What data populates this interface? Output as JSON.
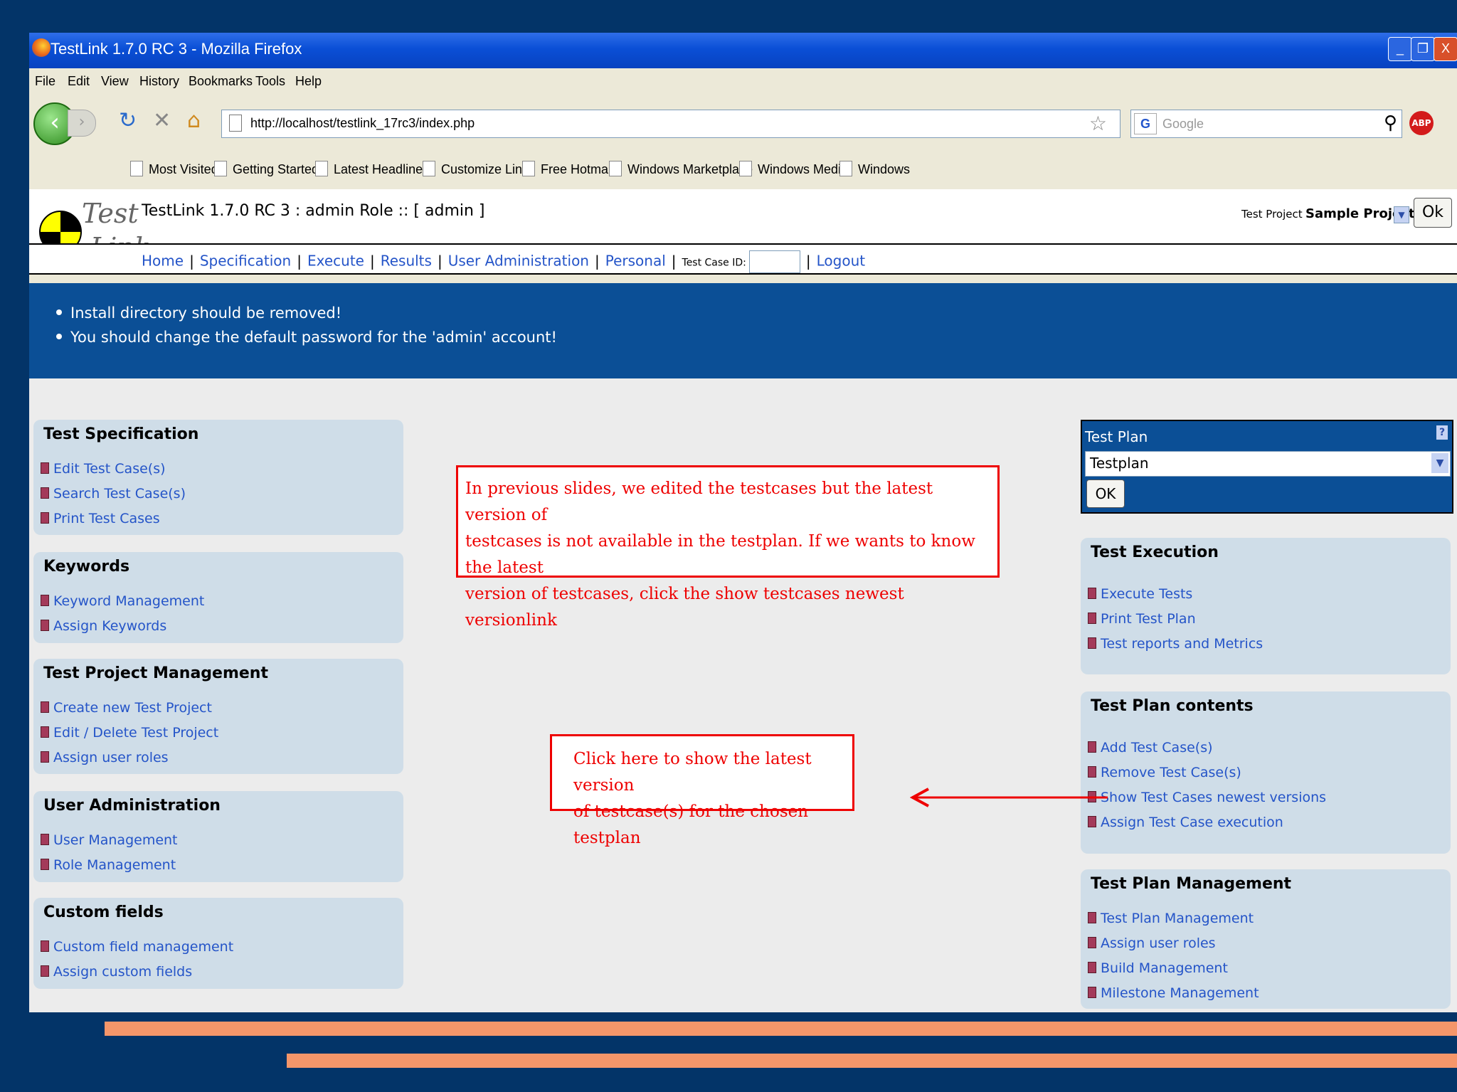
{
  "window": {
    "title": "TestLink 1.7.0 RC 3 - Mozilla Firefox"
  },
  "menu": [
    "File",
    "Edit",
    "View",
    "History",
    "Bookmarks",
    "Tools",
    "Help"
  ],
  "nav": {
    "url": "http://localhost/testlink_17rc3/index.php",
    "search_placeholder": "Google"
  },
  "bookmarks": [
    "Most Visited",
    "Getting Started",
    "Latest Headlines",
    "Customize Links",
    "Free Hotmail",
    "Windows Marketplace",
    "Windows Media",
    "Windows"
  ],
  "testlink": {
    "logo": {
      "word1": "Test",
      "word2": "Link"
    },
    "title": "TestLink 1.7.0 RC 3 : admin Role :: [ admin ]",
    "project_label": "Test Project",
    "project_value": "Sample Project",
    "ok_label": "Ok",
    "nav": {
      "home": "Home",
      "specification": "Specification",
      "execute": "Execute",
      "results": "Results",
      "user_admin": "User Administration",
      "personal": "Personal",
      "testcase_id": "Test Case ID:",
      "logout": "Logout"
    }
  },
  "warnings": [
    "Install directory should be removed!",
    "You should change the default password for the 'admin' account!"
  ],
  "left_panels": [
    {
      "title": "Test Specification",
      "items": [
        "Edit Test Case(s)",
        "Search Test Case(s)",
        "Print Test Cases"
      ]
    },
    {
      "title": "Keywords",
      "items": [
        "Keyword Management",
        "Assign Keywords"
      ]
    },
    {
      "title": "Test Project Management",
      "items": [
        "Create new Test Project",
        "Edit / Delete Test Project",
        "Assign user roles"
      ]
    },
    {
      "title": "User Administration",
      "items": [
        "User Management",
        "Role Management"
      ]
    },
    {
      "title": "Custom fields",
      "items": [
        "Custom field management",
        "Assign custom fields"
      ]
    }
  ],
  "test_plan": {
    "label": "Test Plan",
    "help": "?",
    "selected": "Testplan",
    "ok": "OK"
  },
  "right_panels": [
    {
      "title": "Test Execution",
      "items": [
        "Execute Tests",
        "Print Test Plan",
        "Test reports and Metrics"
      ]
    },
    {
      "title": "Test Plan contents",
      "items": [
        "Add Test Case(s)",
        "Remove Test Case(s)",
        "Show Test Cases newest versions",
        "Assign Test Case execution"
      ]
    },
    {
      "title": "Test Plan Management",
      "items": [
        "Test Plan Management",
        "Assign user roles",
        "Build Management",
        "Milestone Management"
      ]
    }
  ],
  "annotations": {
    "note1": [
      "In previous slides, we edited the testcases but the latest version of",
      "testcases is not available in the testplan. If we wants to know the latest",
      "version of testcases, click the show testcases newest versionlink"
    ],
    "note2": [
      "Click here to show the latest version",
      "of testcase(s) for the chosen testplan"
    ]
  },
  "colors": {
    "slide_bg": "#033468",
    "accent_stripe": "#f5966a",
    "annotation": "#e00000",
    "link": "#2454c8"
  }
}
